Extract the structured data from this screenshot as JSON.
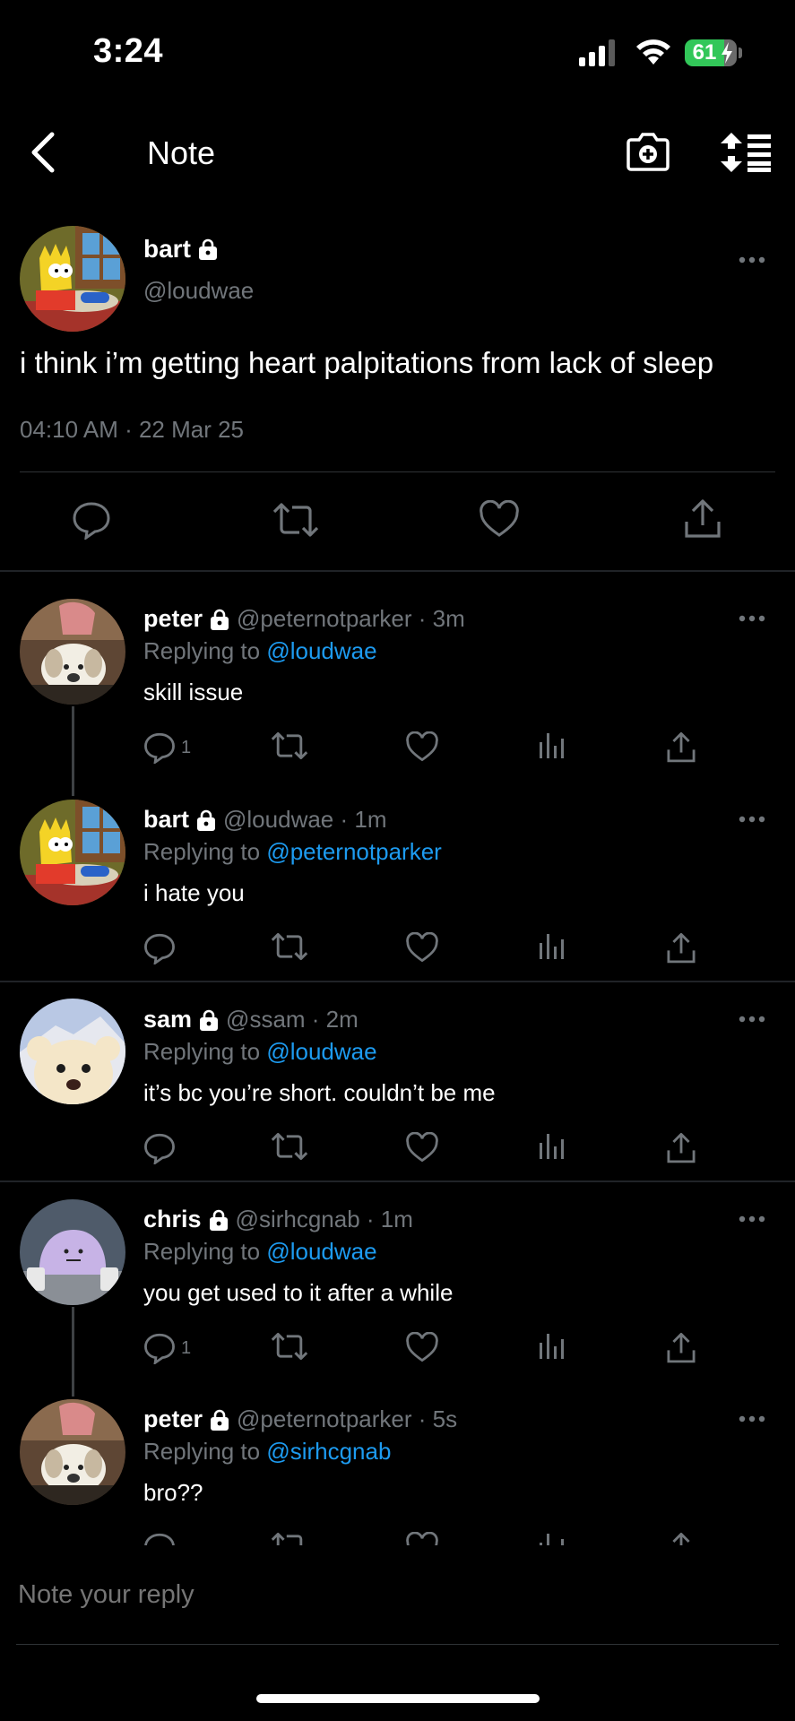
{
  "status_bar": {
    "time": "3:24",
    "battery": "61"
  },
  "header": {
    "title": "Note"
  },
  "main_post": {
    "name": "bart",
    "handle": "@loudwae",
    "text": "i think i’m getting heart palpitations from lack of sleep",
    "timestamp": "04:10 AM · 22 Mar 25"
  },
  "replies": [
    {
      "name": "peter",
      "handle_time": "@peternotparker · 3m",
      "replying_label": "Replying to",
      "replying_to": "@loudwae",
      "text": "skill issue",
      "reply_count": "1"
    },
    {
      "name": "bart",
      "handle_time": "@loudwae · 1m",
      "replying_label": "Replying to",
      "replying_to": "@peternotparker",
      "text": "i hate you",
      "reply_count": ""
    },
    {
      "name": "sam",
      "handle_time": "@ssam · 2m",
      "replying_label": "Replying to",
      "replying_to": "@loudwae",
      "text": "it’s bc you’re short. couldn’t be me",
      "reply_count": ""
    },
    {
      "name": "chris",
      "handle_time": "@sirhcgnab · 1m",
      "replying_label": "Replying to",
      "replying_to": "@loudwae",
      "text": "you get used to it after a while",
      "reply_count": "1"
    },
    {
      "name": "peter",
      "handle_time": "@peternotparker · 5s",
      "replying_label": "Replying to",
      "replying_to": "@sirhcgnab",
      "text": "bro??",
      "reply_count": ""
    }
  ],
  "composer": {
    "placeholder": "Note your reply"
  },
  "colors": {
    "background": "#000000",
    "accent": "#1d9bf0",
    "muted": "#71767b",
    "battery": "#32c759"
  }
}
